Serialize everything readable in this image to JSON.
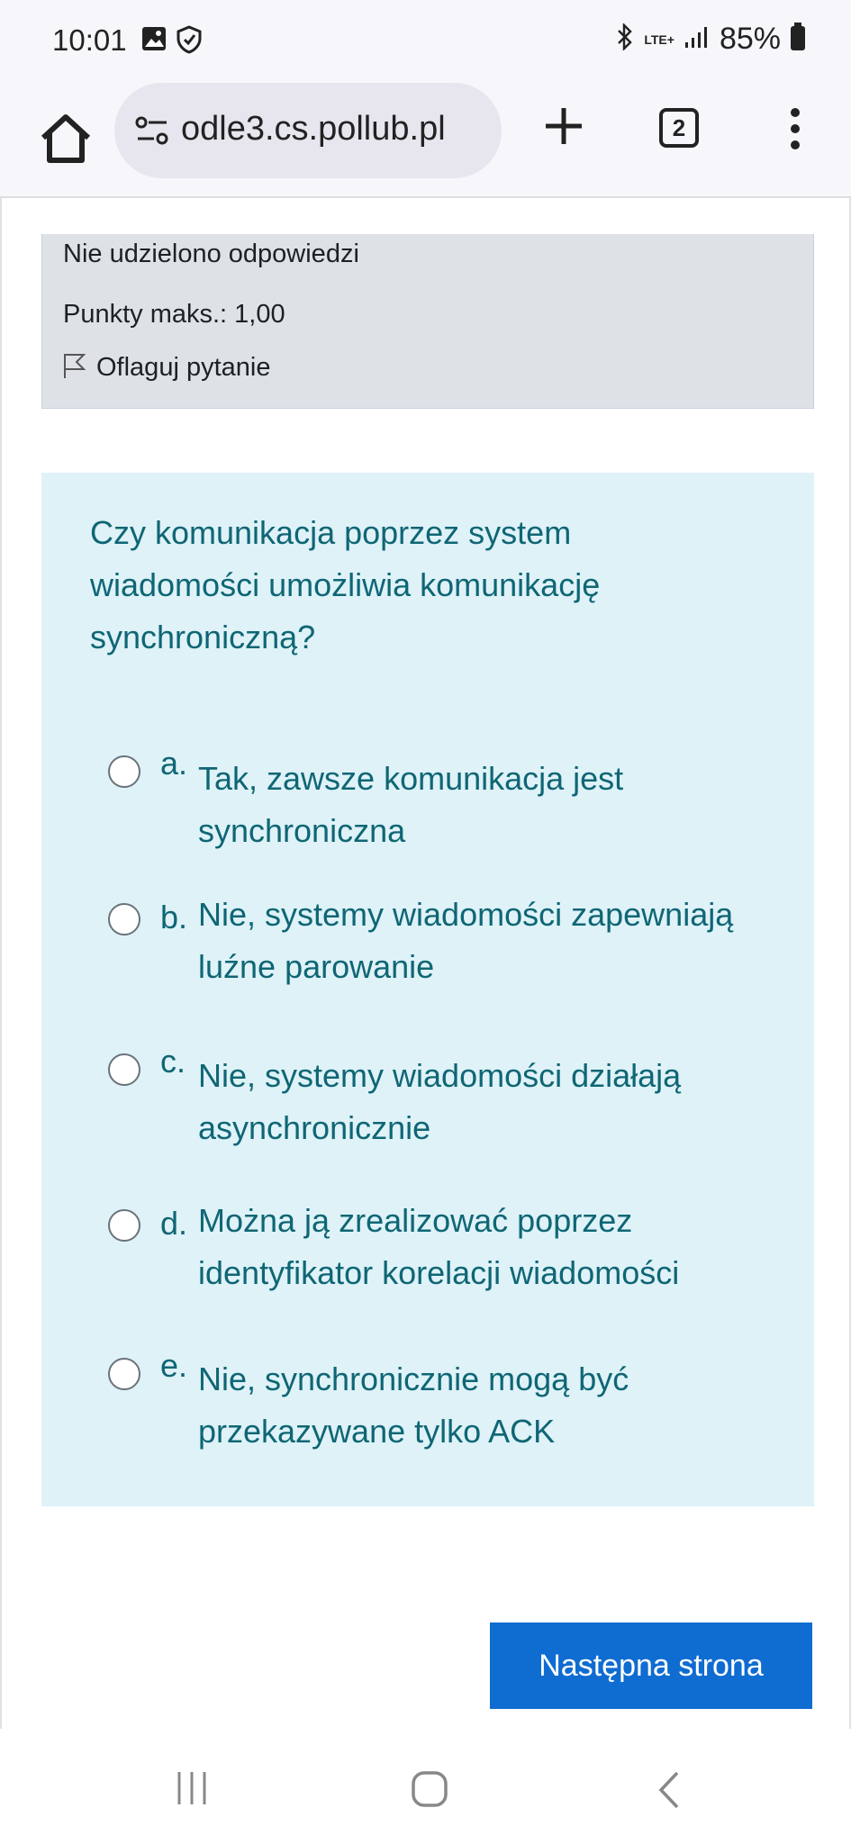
{
  "status_bar": {
    "time": "10:01",
    "network": "LTE+",
    "battery": "85%"
  },
  "browser": {
    "url": "odle3.cs.pollub.pl",
    "tab_count": "2"
  },
  "previous_question": {
    "status": "Nie udzielono odpowiedzi",
    "max_points": "Punkty maks.: 1,00",
    "flag_label": "Oflaguj pytanie"
  },
  "question": {
    "text": "Czy komunikacja poprzez system wiadomości umożliwia komunikację synchroniczną?",
    "options": [
      {
        "letter": "a.",
        "text": "Tak, zawsze komunikacja jest synchroniczna"
      },
      {
        "letter": "b.",
        "text": "Nie, systemy wiadomości zapewniają luźne parowanie"
      },
      {
        "letter": "c.",
        "text": "Nie, systemy wiadomości działają asynchronicznie"
      },
      {
        "letter": "d.",
        "text": "Można ją zrealizować poprzez identyfikator korelacji wiadomości"
      },
      {
        "letter": "e.",
        "text": "Nie, synchronicznie mogą być przekazywane tylko ACK"
      }
    ]
  },
  "next_button_label": "Następna strona",
  "colors": {
    "question_bg": "#def2f8",
    "question_text": "#0f6674",
    "info_bg": "#dee2e6",
    "button_bg": "#0f6cd1"
  }
}
